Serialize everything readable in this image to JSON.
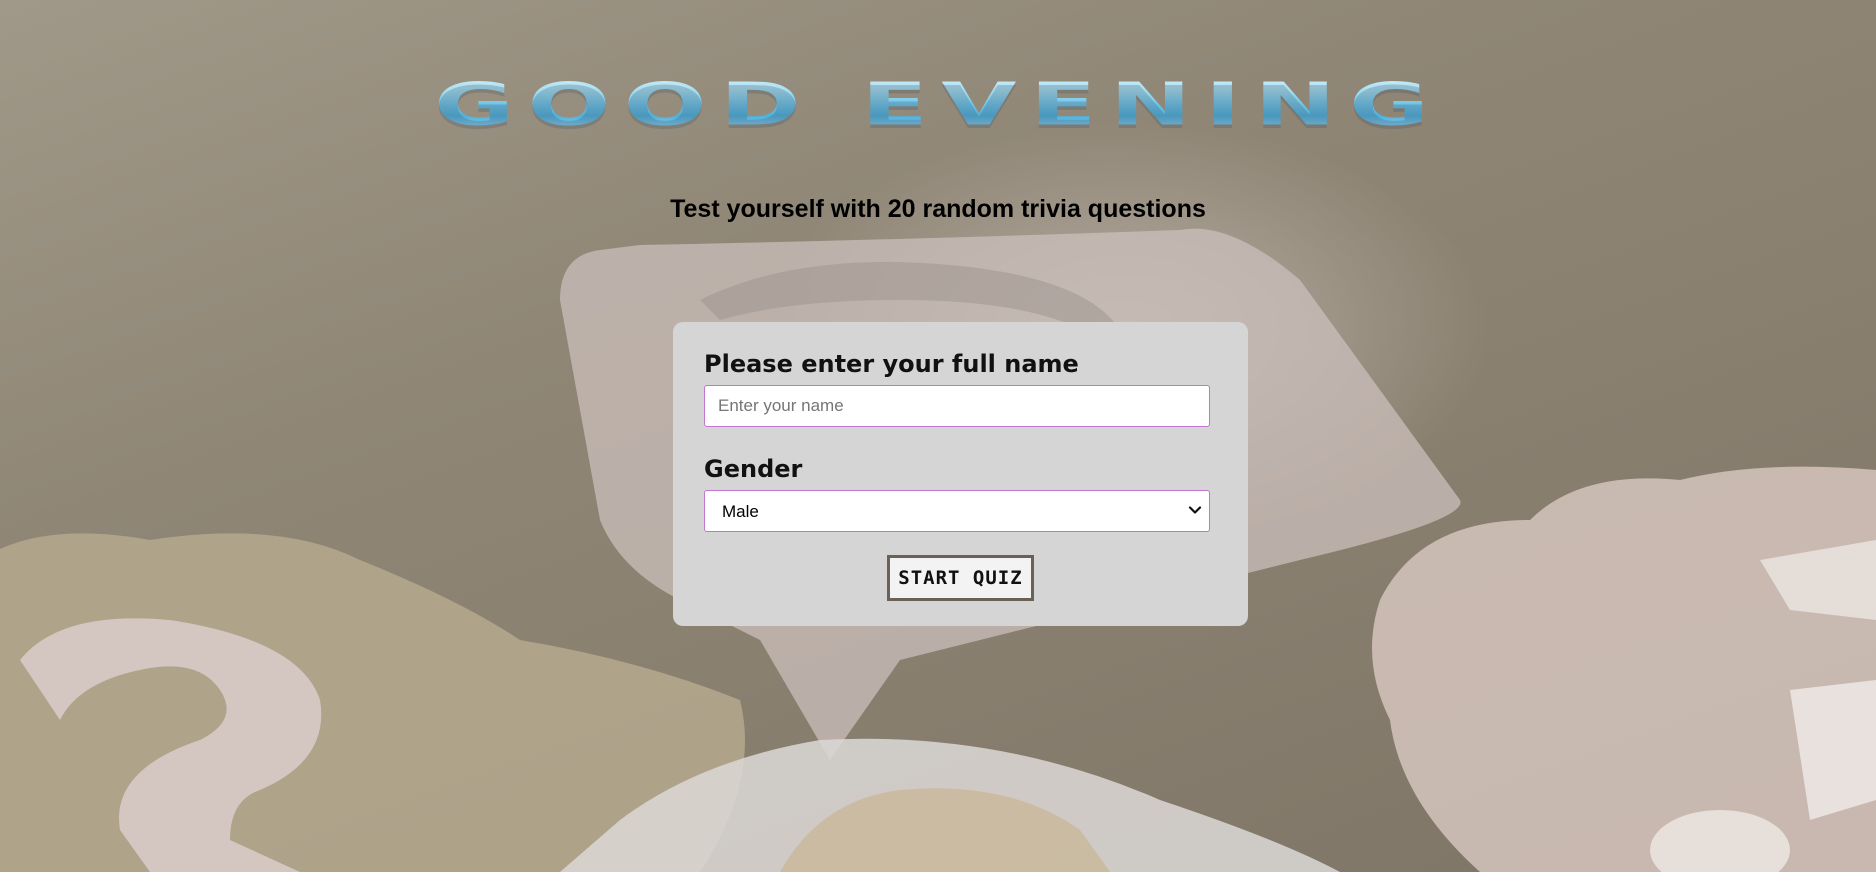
{
  "hero": {
    "title": "GOOD EVENING"
  },
  "subtitle": "Test yourself with 20 random trivia questions",
  "form": {
    "name_label": "Please enter your full name",
    "name_placeholder": "Enter your name",
    "name_value": "",
    "gender_label": "Gender",
    "gender_selected": "Male",
    "submit_label": "START QUIZ"
  },
  "colors": {
    "card_background": "#d5d5d5",
    "input_border": "#c276cf",
    "title_gradient_top": "#d8f1fa",
    "title_gradient_mid": "#4fb0dc",
    "button_border": "#6b6257"
  },
  "icons": {
    "select_chevron": "chevron-down-icon"
  }
}
